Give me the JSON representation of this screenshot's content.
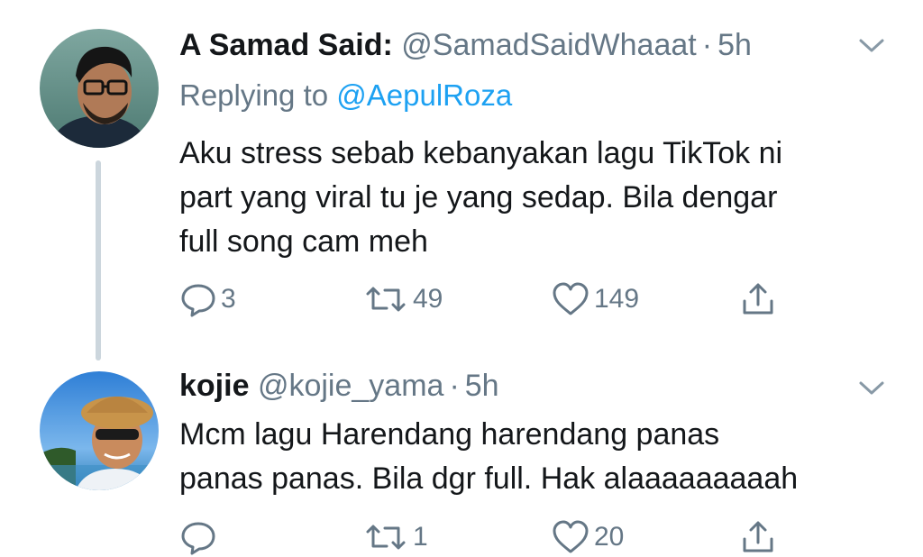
{
  "colors": {
    "accent": "#1da1f2",
    "secondary_text": "#657786",
    "primary_text": "#14171a",
    "thread_line": "#ccd6dd"
  },
  "tweets": [
    {
      "display_name": "A Samad Said:",
      "handle": "@SamadSaidWhaaat",
      "separator": "·",
      "time": "5h",
      "replying_prefix": "Replying to",
      "replying_to": "@AepulRoza",
      "text_lines": [
        "Aku stress sebab kebanyakan lagu TikTok ni",
        "part yang viral tu je yang sedap. Bila dengar",
        "full song cam meh"
      ],
      "replies": "3",
      "retweets": "49",
      "likes": "149",
      "icons": [
        "reply-icon",
        "retweet-icon",
        "like-icon",
        "share-icon",
        "chevron-down-icon"
      ]
    },
    {
      "display_name": "kojie",
      "handle": "@kojie_yama",
      "separator": "·",
      "time": "5h",
      "text_lines": [
        "Mcm lagu Harendang harendang panas",
        "panas panas. Bila dgr full. Hak alaaaaaaaaah"
      ],
      "replies": "",
      "retweets": "1",
      "likes": "20",
      "icons": [
        "reply-icon",
        "retweet-icon",
        "like-icon",
        "share-icon",
        "chevron-down-icon"
      ]
    }
  ]
}
